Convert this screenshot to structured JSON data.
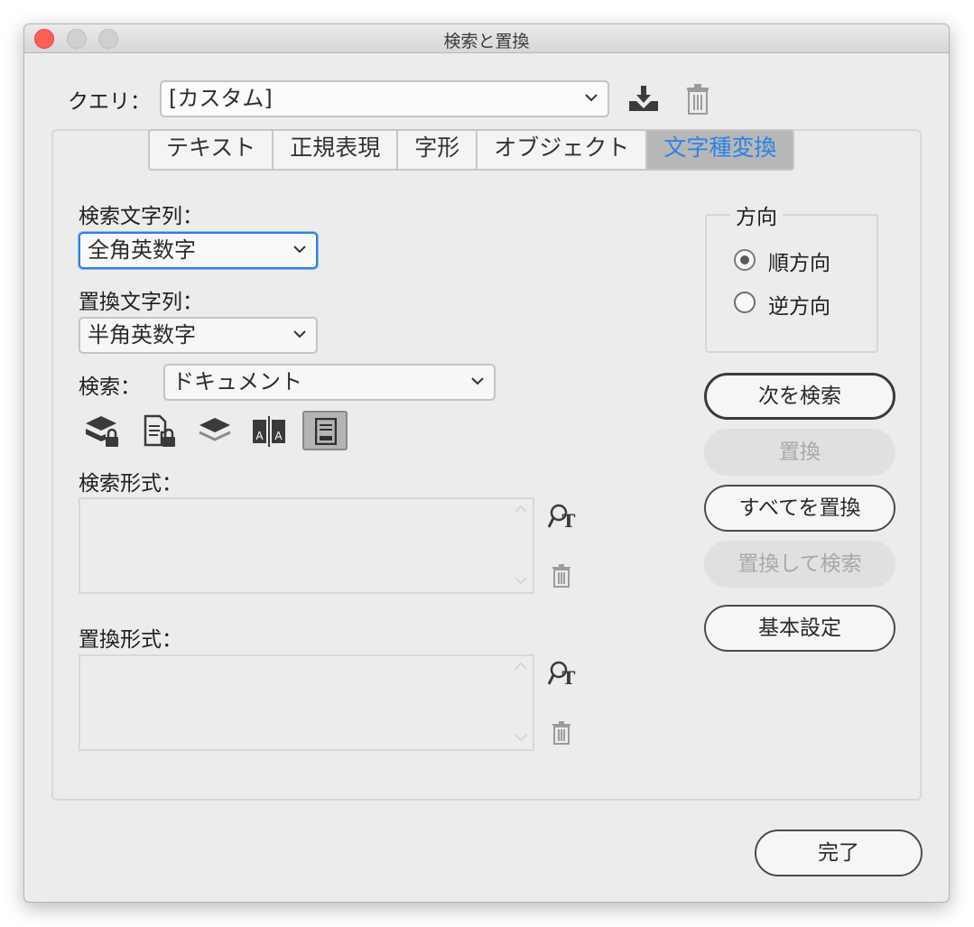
{
  "window": {
    "title": "検索と置換"
  },
  "query": {
    "label": "クエリ：",
    "value": "[カスタム]"
  },
  "tabs": [
    {
      "label": "テキスト",
      "active": false
    },
    {
      "label": "正規表現",
      "active": false
    },
    {
      "label": "字形",
      "active": false
    },
    {
      "label": "オブジェクト",
      "active": false
    },
    {
      "label": "文字種変換",
      "active": true
    }
  ],
  "search_string": {
    "label": "検索文字列：",
    "value": "全角英数字"
  },
  "replace_string": {
    "label": "置換文字列：",
    "value": "半角英数字"
  },
  "search_scope": {
    "label": "検索：",
    "value": "ドキュメント"
  },
  "search_format": {
    "label": "検索形式："
  },
  "replace_format": {
    "label": "置換形式："
  },
  "direction": {
    "legend": "方向",
    "options": [
      {
        "label": "順方向",
        "selected": true
      },
      {
        "label": "逆方向",
        "selected": false
      }
    ]
  },
  "buttons": {
    "find_next": "次を検索",
    "replace": "置換",
    "replace_all": "すべてを置換",
    "replace_find": "置換して検索",
    "preferences": "基本設定",
    "done": "完了"
  },
  "colors": {
    "accent": "#2b82e6",
    "close_button": "#fc5f57",
    "active_tab_bg": "#b7b7b7"
  },
  "icons": {
    "save_query": "download-icon",
    "delete_query": "trash-icon",
    "include_locked_layers": "locked-layers-icon",
    "include_locked_stories": "locked-stories-icon",
    "include_hidden_layers": "hidden-layers-icon",
    "include_master_pages": "master-pages-icon",
    "include_footnotes": "footnotes-icon",
    "specify_format": "format-search-icon",
    "clear_format": "trash-icon"
  }
}
